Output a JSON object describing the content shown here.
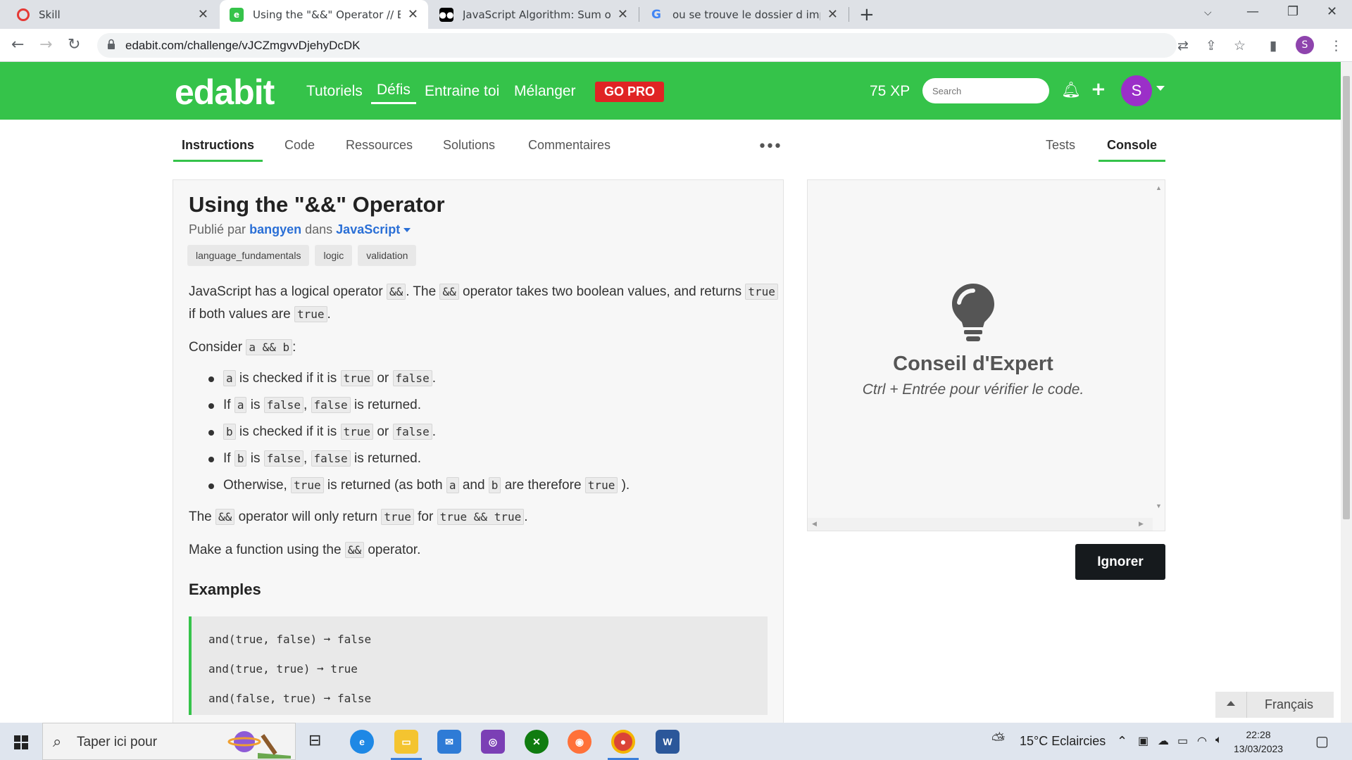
{
  "browser": {
    "tabs": [
      {
        "title": "Skill",
        "favicon": "skill-favicon"
      },
      {
        "title": "Using the \"&&\" Operator // Edab",
        "favicon": "edabit-favicon"
      },
      {
        "title": "JavaScript Algorithm: Sum of Pol",
        "favicon": "medium-favicon"
      },
      {
        "title": "ou se trouve le dossier d imprim",
        "favicon": "google-favicon"
      }
    ],
    "url": "edabit.com/challenge/vJCZmgvvDjehyDcDK",
    "profile_initial": "S"
  },
  "header": {
    "logo": "edabit",
    "nav": [
      "Tutoriels",
      "Défis",
      "Entraine toi",
      "Mélanger"
    ],
    "gopro": "GO PRO",
    "xp": "75 XP",
    "search_placeholder": "Search",
    "avatar_initial": "S",
    "brand_color": "#35c34a"
  },
  "subtabs": {
    "left": [
      "Instructions",
      "Code",
      "Ressources",
      "Solutions",
      "Commentaires"
    ],
    "right": [
      "Tests",
      "Console"
    ],
    "more": "•••"
  },
  "challenge": {
    "title": "Using the \"&&\" Operator",
    "published_by": "Publié par",
    "author": "bangyen",
    "in_word": "dans",
    "language": "JavaScript",
    "tags": [
      "language_fundamentals",
      "logic",
      "validation"
    ],
    "p1_a": "JavaScript has a logical operator",
    "p1_code1": "&&",
    "p1_b": ". The",
    "p1_code2": "&&",
    "p1_c": "operator takes two boolean values, and returns",
    "p1_code3": "true",
    "p1_d": "if both values are",
    "p1_code4": "true",
    "p1_e": ".",
    "p2_a": "Consider",
    "p2_code": "a && b",
    "p2_b": ":",
    "bullets": {
      "b1": {
        "c1": "a",
        "t1": "is checked if it is",
        "c2": "true",
        "t2": "or",
        "c3": "false",
        "t3": "."
      },
      "b2": {
        "t0": "If",
        "c1": "a",
        "t1": "is",
        "c2": "false",
        "t2": ",",
        "c3": "false",
        "t3": "is returned."
      },
      "b3": {
        "c1": "b",
        "t1": "is checked if it is",
        "c2": "true",
        "t2": "or",
        "c3": "false",
        "t3": "."
      },
      "b4": {
        "t0": "If",
        "c1": "b",
        "t1": "is",
        "c2": "false",
        "t2": ",",
        "c3": "false",
        "t3": "is returned."
      },
      "b5": {
        "t0": "Otherwise,",
        "c1": "true",
        "t1": "is returned (as both",
        "c2": "a",
        "t2": "and",
        "c3": "b",
        "t3": "are therefore",
        "c4": "true",
        "t4": ")."
      }
    },
    "p3_a": "The",
    "p3_code1": "&&",
    "p3_b": "operator will only return",
    "p3_code2": "true",
    "p3_c": "for",
    "p3_code3": "true && true",
    "p3_d": ".",
    "p4_a": "Make a function using the",
    "p4_code": "&&",
    "p4_b": "operator.",
    "examples_heading": "Examples",
    "examples": [
      "and(true, false) ➞ false",
      "and(true, true) ➞ true",
      "and(false, true) ➞ false"
    ]
  },
  "console": {
    "tip_title": "Conseil d'Expert",
    "tip_text": "Ctrl + Entrée pour vérifier le code.",
    "ignore_button": "Ignorer"
  },
  "language_selector": "Français",
  "taskbar": {
    "search_text": "Taper ici pour",
    "weather": "15°C  Eclaircies",
    "time": "22:28",
    "date": "13/03/2023"
  }
}
